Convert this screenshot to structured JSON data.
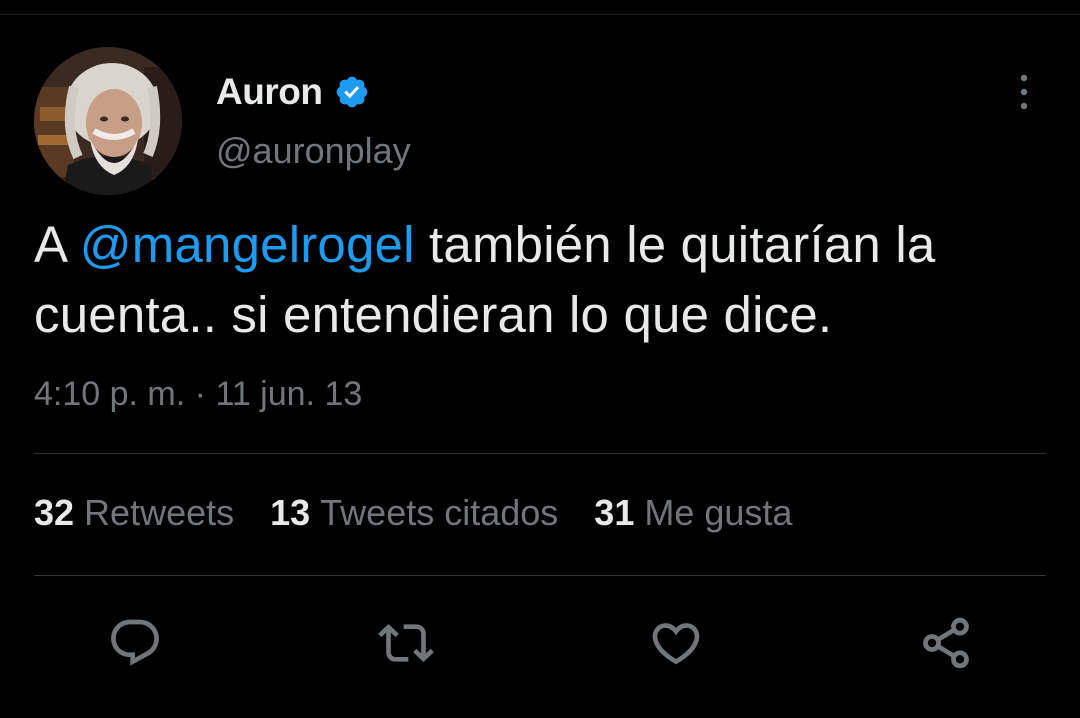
{
  "author": {
    "display_name": "Auron",
    "handle": "@auronplay",
    "verified_icon": "verified-badge-icon"
  },
  "tweet": {
    "text_prefix": "A ",
    "mention": "@mangelrogel",
    "text_suffix": " también le quitarían la cuenta.. si entendieran lo que dice."
  },
  "meta": {
    "time": "4:10 p. m.",
    "separator": "·",
    "date": "11 jun. 13"
  },
  "stats": [
    {
      "count": "32",
      "label": "Retweets"
    },
    {
      "count": "13",
      "label": "Tweets citados"
    },
    {
      "count": "31",
      "label": "Me gusta"
    }
  ],
  "actions": [
    "reply-icon",
    "retweet-icon",
    "like-icon",
    "share-icon"
  ],
  "colors": {
    "background": "#000000",
    "text": "#e7e9ea",
    "secondary": "#71767b",
    "accent": "#1d9bf0",
    "divider": "#2f3336"
  }
}
